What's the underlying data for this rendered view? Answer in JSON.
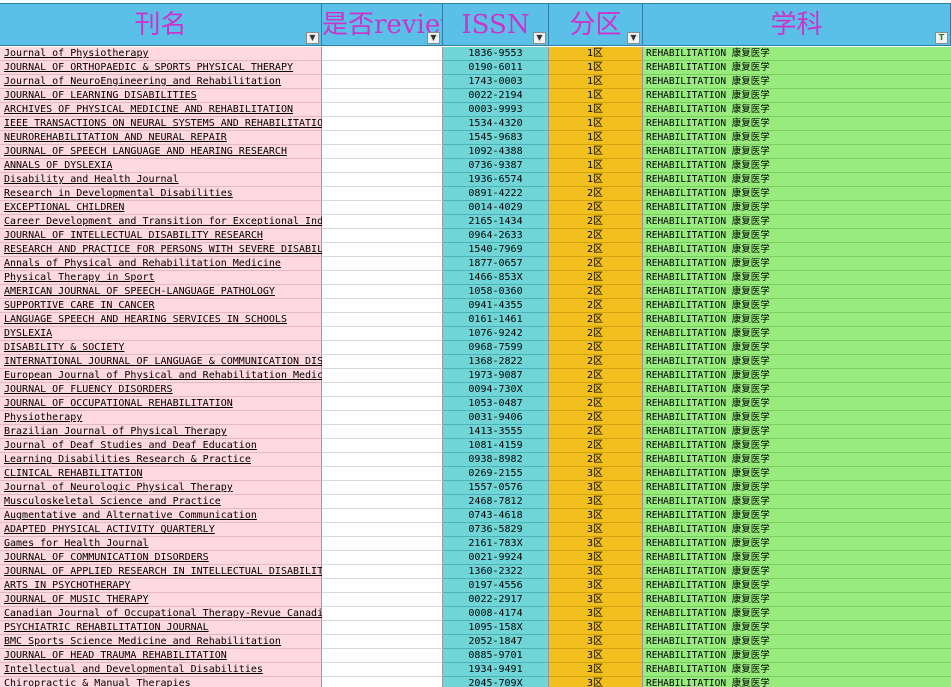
{
  "header": {
    "name": "刊名",
    "review": "是否review",
    "issn": "ISSN",
    "zone": "分区",
    "subject": "学科",
    "filter_glyph": "▼",
    "filter_active_glyph": "T"
  },
  "rows": [
    {
      "name": "Journal of Physiotherapy",
      "issn": "1836-9553",
      "zone": "1区",
      "subject": "REHABILITATION 康复医学"
    },
    {
      "name": "JOURNAL OF ORTHOPAEDIC & SPORTS PHYSICAL THERAPY",
      "issn": "0190-6011",
      "zone": "1区",
      "subject": "REHABILITATION 康复医学"
    },
    {
      "name": "Journal of NeuroEngineering and Rehabilitation",
      "issn": "1743-0003",
      "zone": "1区",
      "subject": "REHABILITATION 康复医学"
    },
    {
      "name": "JOURNAL OF LEARNING DISABILITIES",
      "issn": "0022-2194",
      "zone": "1区",
      "subject": "REHABILITATION 康复医学"
    },
    {
      "name": "ARCHIVES OF PHYSICAL MEDICINE AND REHABILITATION",
      "issn": "0003-9993",
      "zone": "1区",
      "subject": "REHABILITATION 康复医学"
    },
    {
      "name": "IEEE TRANSACTIONS ON NEURAL SYSTEMS AND REHABILITATION ENGINEERING",
      "issn": "1534-4320",
      "zone": "1区",
      "subject": "REHABILITATION 康复医学"
    },
    {
      "name": "NEUROREHABILITATION AND NEURAL REPAIR",
      "issn": "1545-9683",
      "zone": "1区",
      "subject": "REHABILITATION 康复医学"
    },
    {
      "name": "JOURNAL OF SPEECH LANGUAGE AND HEARING RESEARCH",
      "issn": "1092-4388",
      "zone": "1区",
      "subject": "REHABILITATION 康复医学"
    },
    {
      "name": "ANNALS OF DYSLEXIA",
      "issn": "0736-9387",
      "zone": "1区",
      "subject": "REHABILITATION 康复医学"
    },
    {
      "name": "Disability and Health Journal",
      "issn": "1936-6574",
      "zone": "1区",
      "subject": "REHABILITATION 康复医学"
    },
    {
      "name": "Research in Developmental Disabilities",
      "issn": "0891-4222",
      "zone": "2区",
      "subject": "REHABILITATION 康复医学"
    },
    {
      "name": "EXCEPTIONAL CHILDREN",
      "issn": "0014-4029",
      "zone": "2区",
      "subject": "REHABILITATION 康复医学"
    },
    {
      "name": "Career Development and Transition for Exceptional Individuals",
      "issn": "2165-1434",
      "zone": "2区",
      "subject": "REHABILITATION 康复医学"
    },
    {
      "name": "JOURNAL OF INTELLECTUAL DISABILITY RESEARCH",
      "issn": "0964-2633",
      "zone": "2区",
      "subject": "REHABILITATION 康复医学"
    },
    {
      "name": "RESEARCH AND PRACTICE FOR PERSONS WITH SEVERE DISABILITIES",
      "issn": "1540-7969",
      "zone": "2区",
      "subject": "REHABILITATION 康复医学"
    },
    {
      "name": "Annals of Physical and Rehabilitation Medicine",
      "issn": "1877-0657",
      "zone": "2区",
      "subject": "REHABILITATION 康复医学"
    },
    {
      "name": "Physical Therapy in Sport",
      "issn": "1466-853X",
      "zone": "2区",
      "subject": "REHABILITATION 康复医学"
    },
    {
      "name": "AMERICAN JOURNAL OF SPEECH-LANGUAGE PATHOLOGY",
      "issn": "1058-0360",
      "zone": "2区",
      "subject": "REHABILITATION 康复医学"
    },
    {
      "name": "SUPPORTIVE CARE IN CANCER",
      "issn": "0941-4355",
      "zone": "2区",
      "subject": "REHABILITATION 康复医学"
    },
    {
      "name": "LANGUAGE SPEECH AND HEARING SERVICES IN SCHOOLS",
      "issn": "0161-1461",
      "zone": "2区",
      "subject": "REHABILITATION 康复医学"
    },
    {
      "name": "DYSLEXIA",
      "issn": "1076-9242",
      "zone": "2区",
      "subject": "REHABILITATION 康复医学"
    },
    {
      "name": "DISABILITY & SOCIETY",
      "issn": "0968-7599",
      "zone": "2区",
      "subject": "REHABILITATION 康复医学"
    },
    {
      "name": "INTERNATIONAL JOURNAL OF LANGUAGE & COMMUNICATION DISORDERS",
      "issn": "1368-2822",
      "zone": "2区",
      "subject": "REHABILITATION 康复医学"
    },
    {
      "name": "European Journal of Physical and Rehabilitation Medicine",
      "issn": "1973-9087",
      "zone": "2区",
      "subject": "REHABILITATION 康复医学"
    },
    {
      "name": "JOURNAL OF FLUENCY DISORDERS",
      "issn": "0094-730X",
      "zone": "2区",
      "subject": "REHABILITATION 康复医学"
    },
    {
      "name": "JOURNAL OF OCCUPATIONAL REHABILITATION",
      "issn": "1053-0487",
      "zone": "2区",
      "subject": "REHABILITATION 康复医学"
    },
    {
      "name": "Physiotherapy",
      "issn": "0031-9406",
      "zone": "2区",
      "subject": "REHABILITATION 康复医学"
    },
    {
      "name": "Brazilian Journal of Physical Therapy",
      "issn": "1413-3555",
      "zone": "2区",
      "subject": "REHABILITATION 康复医学"
    },
    {
      "name": "Journal of Deaf Studies and Deaf Education",
      "issn": "1081-4159",
      "zone": "2区",
      "subject": "REHABILITATION 康复医学"
    },
    {
      "name": "Learning Disabilities Research & Practice",
      "issn": "0938-8982",
      "zone": "2区",
      "subject": "REHABILITATION 康复医学"
    },
    {
      "name": "CLINICAL REHABILITATION",
      "issn": "0269-2155",
      "zone": "3区",
      "subject": "REHABILITATION 康复医学"
    },
    {
      "name": "Journal of Neurologic Physical Therapy",
      "issn": "1557-0576",
      "zone": "3区",
      "subject": "REHABILITATION 康复医学"
    },
    {
      "name": "Musculoskeletal Science and Practice",
      "issn": "2468-7812",
      "zone": "3区",
      "subject": "REHABILITATION 康复医学"
    },
    {
      "name": "Augmentative and Alternative Communication",
      "issn": "0743-4618",
      "zone": "3区",
      "subject": "REHABILITATION 康复医学"
    },
    {
      "name": "ADAPTED PHYSICAL ACTIVITY QUARTERLY",
      "issn": "0736-5829",
      "zone": "3区",
      "subject": "REHABILITATION 康复医学"
    },
    {
      "name": "Games for Health Journal",
      "issn": "2161-783X",
      "zone": "3区",
      "subject": "REHABILITATION 康复医学"
    },
    {
      "name": "JOURNAL OF COMMUNICATION DISORDERS",
      "issn": "0021-9924",
      "zone": "3区",
      "subject": "REHABILITATION 康复医学"
    },
    {
      "name": "JOURNAL OF APPLIED RESEARCH IN INTELLECTUAL DISABILITIES",
      "issn": "1360-2322",
      "zone": "3区",
      "subject": "REHABILITATION 康复医学"
    },
    {
      "name": "ARTS IN PSYCHOTHERAPY",
      "issn": "0197-4556",
      "zone": "3区",
      "subject": "REHABILITATION 康复医学"
    },
    {
      "name": "JOURNAL OF MUSIC THERAPY",
      "issn": "0022-2917",
      "zone": "3区",
      "subject": "REHABILITATION 康复医学"
    },
    {
      "name": "Canadian Journal of Occupational Therapy-Revue Canadienne d Ergotherapie",
      "issn": "0008-4174",
      "zone": "3区",
      "subject": "REHABILITATION 康复医学"
    },
    {
      "name": "PSYCHIATRIC REHABILITATION JOURNAL",
      "issn": "1095-158X",
      "zone": "3区",
      "subject": "REHABILITATION 康复医学"
    },
    {
      "name": "BMC Sports Science Medicine and Rehabilitation",
      "issn": "2052-1847",
      "zone": "3区",
      "subject": "REHABILITATION 康复医学"
    },
    {
      "name": "JOURNAL OF HEAD TRAUMA REHABILITATION",
      "issn": "0885-9701",
      "zone": "3区",
      "subject": "REHABILITATION 康复医学"
    },
    {
      "name": "Intellectual and Developmental Disabilities",
      "issn": "1934-9491",
      "zone": "3区",
      "subject": "REHABILITATION 康复医学"
    },
    {
      "name": "Chiropractic & Manual Therapies",
      "issn": "2045-709X",
      "zone": "3区",
      "subject": "REHABILITATION 康复医学"
    }
  ]
}
